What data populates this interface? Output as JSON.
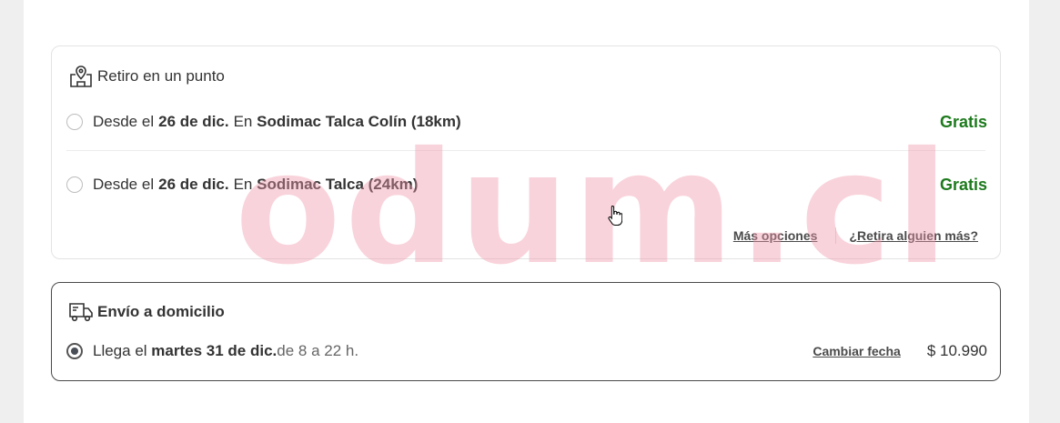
{
  "pickup": {
    "title": "Retiro en un punto",
    "options": [
      {
        "prefix": "Desde el",
        "date": "26 de dic.",
        "mid": "En",
        "store": "Sodimac Talca Colín (18km)",
        "price": "Gratis",
        "selected": false
      },
      {
        "prefix": "Desde el",
        "date": "26 de dic.",
        "mid": "En",
        "store": "Sodimac Talca (24km)",
        "price": "Gratis",
        "selected": false
      }
    ],
    "more_options": "Más opciones",
    "someone_else": "¿Retira alguien más?"
  },
  "delivery": {
    "title": "Envío a domicilio",
    "prefix": "Llega el",
    "date": "martes 31 de dic.",
    "time": "de 8 a 22 h.",
    "change_date": "Cambiar fecha",
    "price": "$ 10.990",
    "selected": true
  },
  "watermark": "odum.cl",
  "colors": {
    "free_price": "#1d7a1d",
    "watermark": "#f4a8b8"
  }
}
